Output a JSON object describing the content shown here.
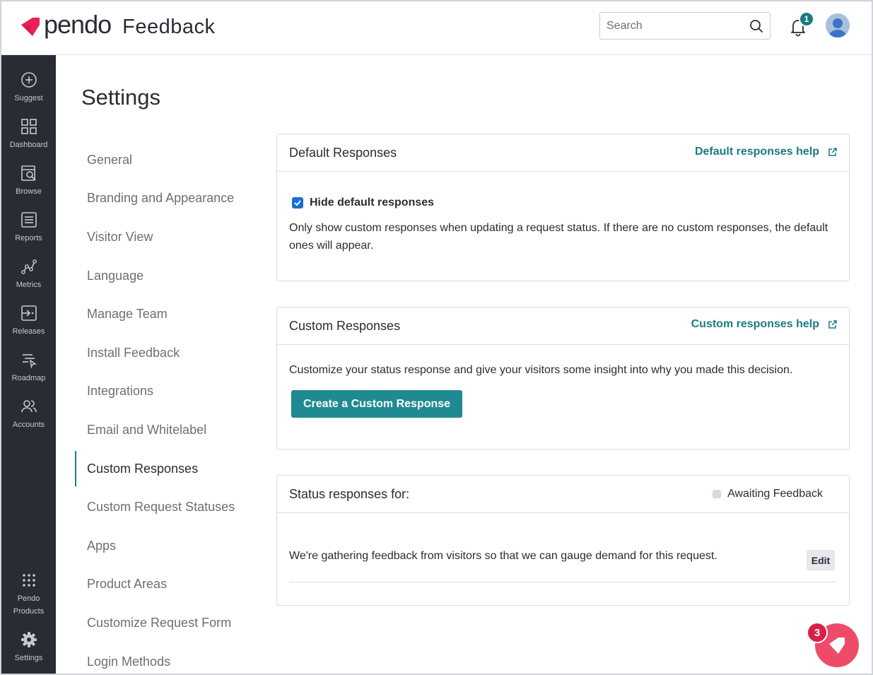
{
  "header": {
    "logo_word": "pendo",
    "product_name": "Feedback",
    "search_placeholder": "Search",
    "notification_count": "1",
    "brand_color": "#ec2059"
  },
  "leftnav": {
    "items": [
      {
        "label": "Suggest",
        "icon": "plus-circle-icon"
      },
      {
        "label": "Dashboard",
        "icon": "grid-icon"
      },
      {
        "label": "Browse",
        "icon": "browse-icon"
      },
      {
        "label": "Reports",
        "icon": "document-icon"
      },
      {
        "label": "Metrics",
        "icon": "metrics-icon"
      },
      {
        "label": "Releases",
        "icon": "releases-icon"
      },
      {
        "label": "Roadmap",
        "icon": "roadmap-icon"
      },
      {
        "label": "Accounts",
        "icon": "users-icon"
      }
    ],
    "bottom": [
      {
        "label_line1": "Pendo",
        "label_line2": "Products",
        "icon": "apps-grid-icon"
      },
      {
        "label": "Settings",
        "icon": "gear-icon"
      }
    ]
  },
  "page": {
    "title": "Settings"
  },
  "subnav": {
    "items": [
      "General",
      "Branding and Appearance",
      "Visitor View",
      "Language",
      "Manage Team",
      "Install Feedback",
      "Integrations",
      "Email and Whitelabel",
      "Custom Responses",
      "Custom Request Statuses",
      "Apps",
      "Product Areas",
      "Customize Request Form",
      "Login Methods"
    ],
    "active": "Custom Responses"
  },
  "default_responses": {
    "title": "Default Responses",
    "help_link": "Default responses help",
    "checkbox_label": "Hide default responses",
    "checked": true,
    "description": "Only show custom responses when updating a request status. If there are no custom responses, the default ones will appear."
  },
  "custom_responses": {
    "title": "Custom Responses",
    "help_link": "Custom responses help",
    "description": "Customize your status response and give your visitors some insight into why you made this decision.",
    "create_button": "Create a Custom Response"
  },
  "status_responses": {
    "title": "Status responses for:",
    "status": "Awaiting Feedback",
    "response_text": "We're gathering feedback from visitors so that we can gauge demand for this request.",
    "edit_button": "Edit"
  },
  "launcher": {
    "badge_count": "3"
  }
}
